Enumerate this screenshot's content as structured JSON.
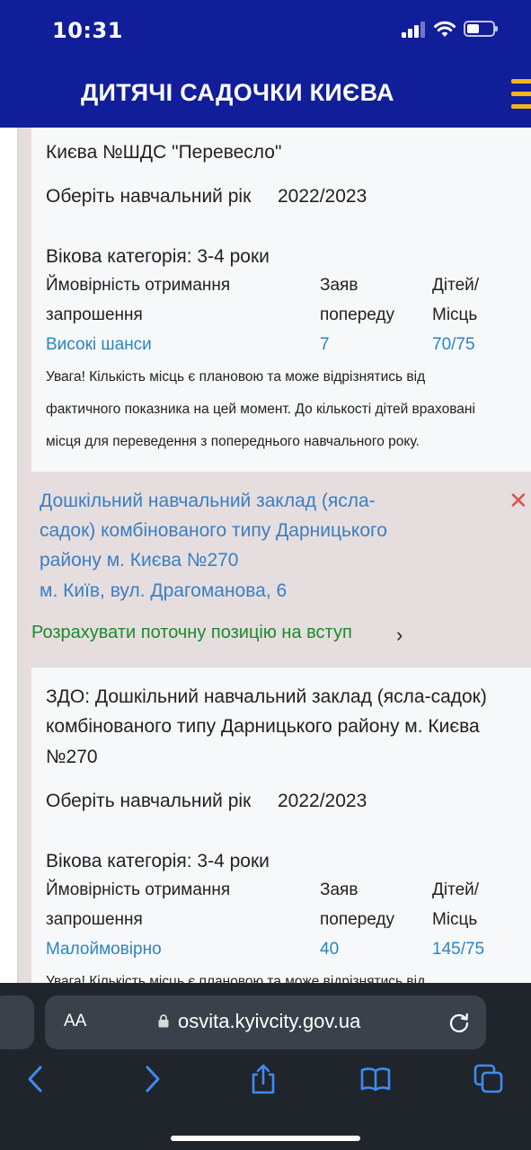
{
  "status": {
    "time": "10:31"
  },
  "header": {
    "title": "ДИТЯЧІ САДОЧКИ КИЄВА"
  },
  "card1": {
    "title_tail": "Києва №ШДС \"Перевесло\"",
    "year_label": "Оберіть навчальний рік",
    "year_value": "2022/2023",
    "age_category": "Вікова категорія: 3-4 роки",
    "col1_line1": "Ймовірність отримання",
    "col1_line2": "запрошення",
    "col2_line1": "Заяв",
    "col2_line2": "попереду",
    "col3_line1": "Дітей/",
    "col3_line2": "Місць",
    "chance": "Високі шанси",
    "applications_ahead": "7",
    "children_places": "70/75",
    "note_line1": "Увага! Кількість місць є плановою та може відрізнятись від",
    "note_line2": "фактичного показника на цей момент. До кількості дітей враховані",
    "note_line3": "місця для переведення з попереднього навчального року."
  },
  "kindergarten_link": {
    "line1": "Дошкільний навчальний заклад (ясла-",
    "line2": "садок) комбінованого типу Дарницького",
    "line3": "району м. Києва №270",
    "address": "м. Київ, вул. Драгоманова, 6",
    "close_glyph": "✕"
  },
  "calc_link": {
    "label": "Розрахувати поточну позицію на вступ",
    "chevron": "›"
  },
  "card2": {
    "title_line1": "ЗДО: Дошкільний навчальний заклад (ясла-садок)",
    "title_line2": "комбінованого типу Дарницького району м. Києва",
    "title_line3": "№270",
    "year_label": "Оберіть навчальний рік",
    "year_value": "2022/2023",
    "age_category": "Вікова категорія: 3-4 роки",
    "col1_line1": "Ймовірність отримання",
    "col1_line2": "запрошення",
    "col2_line1": "Заяв",
    "col2_line2": "попереду",
    "col3_line1": "Дітей/",
    "col3_line2": "Місць",
    "chance": "Малоймовірно",
    "applications_ahead": "40",
    "children_places": "145/75",
    "note_line1": "Увага! Кількість місць є плановою та може відрізнятись від"
  },
  "browser": {
    "text_size_label": "AA",
    "url": "osvita.kyivcity.gov.ua",
    "icons": [
      "back-icon",
      "forward-icon",
      "share-icon",
      "bookmarks-icon",
      "tabs-icon"
    ]
  },
  "colors": {
    "header_bg": "#111e9a",
    "menu_accent": "#f2b51b",
    "link_blue": "#2a85c2",
    "calc_green": "#1b8a2b",
    "close_red": "#e05050",
    "panel_bg": "#e6dede",
    "browser_bg": "#20252c"
  }
}
